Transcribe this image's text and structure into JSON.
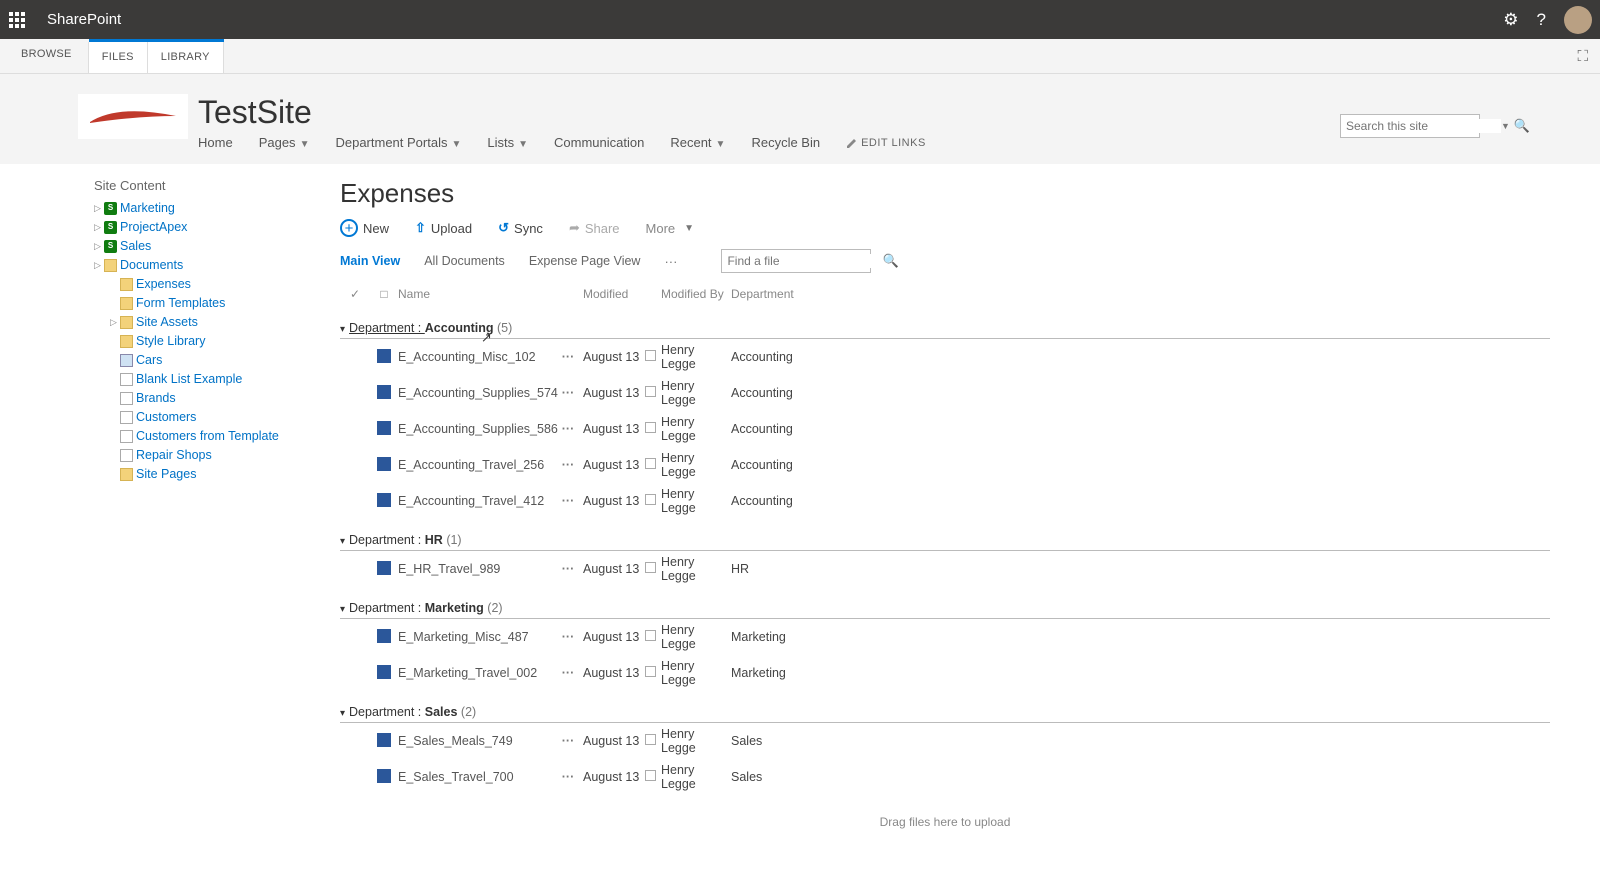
{
  "suite": {
    "title": "SharePoint"
  },
  "ribbon": {
    "browse": "BROWSE",
    "files": "FILES",
    "library": "LIBRARY"
  },
  "site": {
    "title": "TestSite",
    "nav": {
      "home": "Home",
      "pages": "Pages",
      "dept": "Department Portals",
      "lists": "Lists",
      "comm": "Communication",
      "recent": "Recent",
      "recycle": "Recycle Bin",
      "edit": "EDIT LINKS"
    },
    "search_placeholder": "Search this site"
  },
  "leftnav": {
    "title": "Site Content",
    "items": [
      {
        "label": "Marketing",
        "icon": "green",
        "caret": true
      },
      {
        "label": "ProjectApex",
        "icon": "green",
        "caret": true
      },
      {
        "label": "Sales",
        "icon": "green",
        "caret": true
      },
      {
        "label": "Documents",
        "icon": "folder",
        "caret": true
      },
      {
        "label": "Expenses",
        "icon": "folder",
        "caret": false,
        "indent": true
      },
      {
        "label": "Form Templates",
        "icon": "folder",
        "caret": false,
        "indent": true
      },
      {
        "label": "Site Assets",
        "icon": "folder",
        "caret": true,
        "indent": true
      },
      {
        "label": "Style Library",
        "icon": "folder",
        "caret": false,
        "indent": true
      },
      {
        "label": "Cars",
        "icon": "img",
        "caret": false,
        "indent": true
      },
      {
        "label": "Blank List Example",
        "icon": "list",
        "caret": false,
        "indent": true
      },
      {
        "label": "Brands",
        "icon": "list",
        "caret": false,
        "indent": true
      },
      {
        "label": "Customers",
        "icon": "list",
        "caret": false,
        "indent": true
      },
      {
        "label": "Customers from Template",
        "icon": "list",
        "caret": false,
        "indent": true
      },
      {
        "label": "Repair Shops",
        "icon": "list",
        "caret": false,
        "indent": true
      },
      {
        "label": "Site Pages",
        "icon": "folder",
        "caret": false,
        "indent": true
      }
    ]
  },
  "list": {
    "title": "Expenses",
    "cmds": {
      "new": "New",
      "upload": "Upload",
      "sync": "Sync",
      "share": "Share",
      "more": "More"
    },
    "views": {
      "main": "Main View",
      "all": "All Documents",
      "page": "Expense Page View"
    },
    "find_placeholder": "Find a file",
    "columns": {
      "name": "Name",
      "modified": "Modified",
      "by": "Modified By",
      "dept": "Department"
    },
    "group_prefix": "Department : ",
    "groups": [
      {
        "value": "Accounting",
        "count": 5,
        "first": true,
        "items": [
          {
            "name": "E_Accounting_Misc_102",
            "modified": "August 13",
            "by": "Henry Legge",
            "dept": "Accounting"
          },
          {
            "name": "E_Accounting_Supplies_574",
            "modified": "August 13",
            "by": "Henry Legge",
            "dept": "Accounting"
          },
          {
            "name": "E_Accounting_Supplies_586",
            "modified": "August 13",
            "by": "Henry Legge",
            "dept": "Accounting"
          },
          {
            "name": "E_Accounting_Travel_256",
            "modified": "August 13",
            "by": "Henry Legge",
            "dept": "Accounting"
          },
          {
            "name": "E_Accounting_Travel_412",
            "modified": "August 13",
            "by": "Henry Legge",
            "dept": "Accounting"
          }
        ]
      },
      {
        "value": "HR",
        "count": 1,
        "items": [
          {
            "name": "E_HR_Travel_989",
            "modified": "August 13",
            "by": "Henry Legge",
            "dept": "HR"
          }
        ]
      },
      {
        "value": "Marketing",
        "count": 2,
        "items": [
          {
            "name": "E_Marketing_Misc_487",
            "modified": "August 13",
            "by": "Henry Legge",
            "dept": "Marketing"
          },
          {
            "name": "E_Marketing_Travel_002",
            "modified": "August 13",
            "by": "Henry Legge",
            "dept": "Marketing"
          }
        ]
      },
      {
        "value": "Sales",
        "count": 2,
        "items": [
          {
            "name": "E_Sales_Meals_749",
            "modified": "August 13",
            "by": "Henry Legge",
            "dept": "Sales"
          },
          {
            "name": "E_Sales_Travel_700",
            "modified": "August 13",
            "by": "Henry Legge",
            "dept": "Sales"
          }
        ]
      }
    ],
    "drag_hint": "Drag files here to upload"
  }
}
